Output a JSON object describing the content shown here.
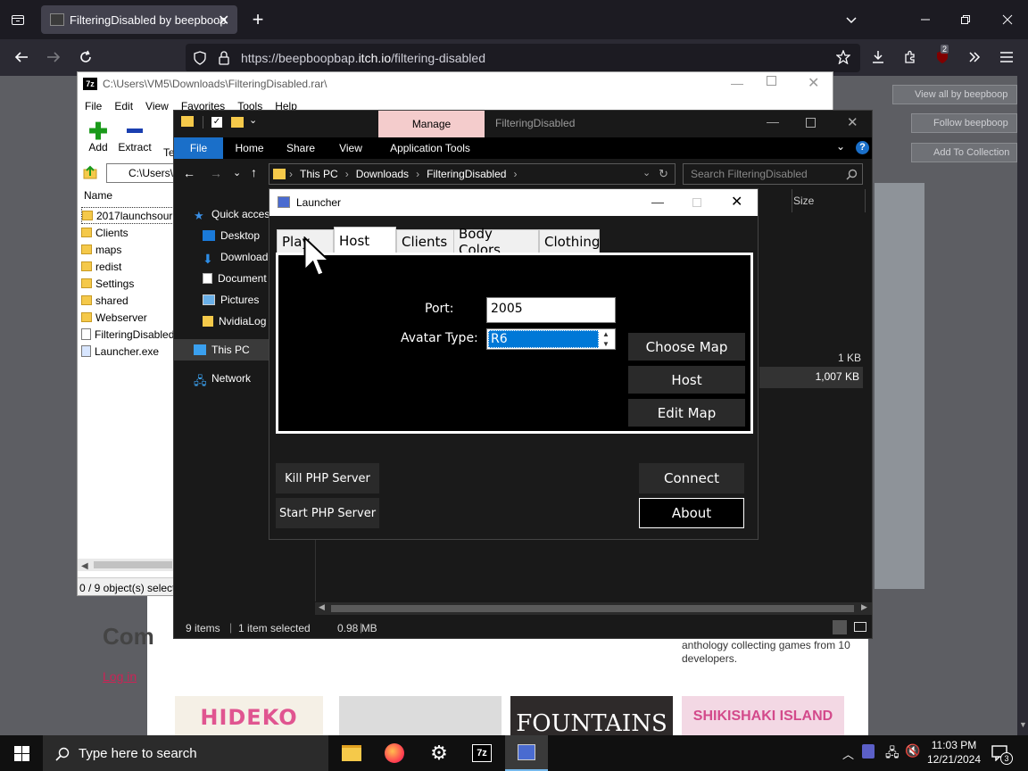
{
  "browser": {
    "tab_title": "FilteringDisabled by beepboop",
    "url_prefix": "https://beepboopbap.",
    "url_domain": "itch.io",
    "url_path": "/filtering-disabled",
    "extension_badge": "2"
  },
  "webpage": {
    "buttons": [
      "View all by beepboop",
      "Follow beepboop",
      "Add To Collection"
    ],
    "comments_heading": "Com",
    "login_link": "Log in",
    "anthology_text": "anthology collecting games from 10 developers.",
    "tile_titles": [
      "HIDEKO",
      "",
      "FOUNTAINS",
      "SHIKISHAKI ISLAND"
    ]
  },
  "sevenzip": {
    "title": "C:\\Users\\VM5\\Downloads\\FilteringDisabled.rar\\",
    "menu": [
      "File",
      "Edit",
      "View",
      "Favorites",
      "Tools",
      "Help"
    ],
    "toolbar": [
      "Add",
      "Extract",
      "Te"
    ],
    "path": "C:\\Users\\",
    "column_name": "Name",
    "files": [
      {
        "name": "2017launchsour",
        "type": "folder"
      },
      {
        "name": "Clients",
        "type": "folder"
      },
      {
        "name": "maps",
        "type": "folder"
      },
      {
        "name": "redist",
        "type": "folder"
      },
      {
        "name": "Settings",
        "type": "folder"
      },
      {
        "name": "shared",
        "type": "folder"
      },
      {
        "name": "Webserver",
        "type": "folder"
      },
      {
        "name": "FilteringDisabled",
        "type": "file"
      },
      {
        "name": "Launcher.exe",
        "type": "exe"
      }
    ],
    "status": "0 / 9 object(s) select"
  },
  "explorer": {
    "manage_label": "Manage",
    "title": "FilteringDisabled",
    "ribbon_tabs": [
      "File",
      "Home",
      "Share",
      "View",
      "Application Tools"
    ],
    "breadcrumb": [
      "This PC",
      "Downloads",
      "FilteringDisabled"
    ],
    "search_placeholder": "Search FilteringDisabled",
    "column_size": "Size",
    "nav": {
      "quick_access": "Quick acces",
      "items": [
        "Desktop",
        "Download",
        "Document",
        "Pictures",
        "NvidiaLog"
      ],
      "this_pc": "This PC",
      "network": "Network"
    },
    "right_text": "t",
    "sizes": [
      "1 KB",
      "1,007 KB"
    ],
    "status": {
      "items": "9 items",
      "selected": "1 item selected",
      "size": "0.98 MB"
    }
  },
  "launcher": {
    "title": "Launcher",
    "tabs": [
      "Play",
      "Host",
      "Clients",
      "Body Colors",
      "Clothing"
    ],
    "active_tab": "Host",
    "port_label": "Port:",
    "port_value": "2005",
    "avatar_label": "Avatar Type:",
    "avatar_value": "R6",
    "buttons": {
      "choose_map": "Choose Map",
      "host": "Host",
      "edit_map": "Edit Map",
      "kill_php": "Kill PHP Server",
      "start_php": "Start PHP Server",
      "connect": "Connect",
      "about": "About"
    }
  },
  "taskbar": {
    "search_placeholder": "Type here to search",
    "time": "11:03 PM",
    "date": "12/21/2024",
    "notification_count": "3"
  }
}
